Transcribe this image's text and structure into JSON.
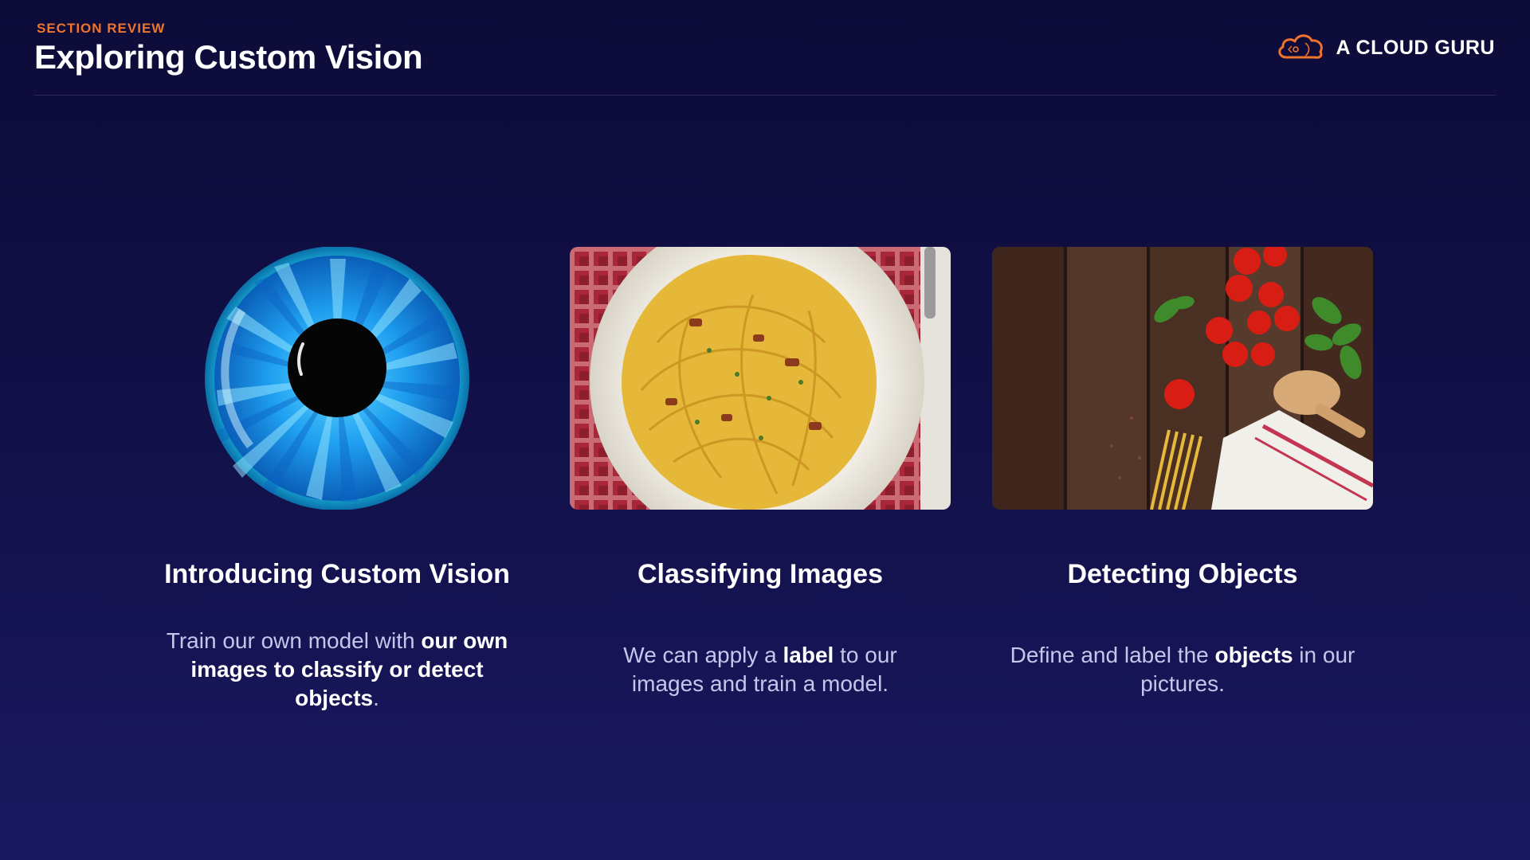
{
  "header": {
    "eyebrow": "SECTION REVIEW",
    "title": "Exploring Custom Vision",
    "brand": "A CLOUD GURU",
    "brand_icon": "cloud-logo-icon"
  },
  "colors": {
    "accent": "#f0742c",
    "background": "#12114a",
    "eye_blue": "#1ea8f0"
  },
  "cards": [
    {
      "image": "eye-illustration",
      "title": "Introducing Custom Vision",
      "text": {
        "pre": "Train our own model with ",
        "bold": "our own images to classify or detect objects",
        "post": "."
      }
    },
    {
      "image": "spaghetti-plate-photo",
      "title": "Classifying Images",
      "text": {
        "pre": "We can apply a ",
        "bold": "label",
        "post": " to our images and train a model."
      }
    },
    {
      "image": "tomatoes-pasta-table-photo",
      "title": "Detecting Objects",
      "text": {
        "pre": "Define and label the ",
        "bold": "objects",
        "post": " in our pictures."
      }
    }
  ]
}
